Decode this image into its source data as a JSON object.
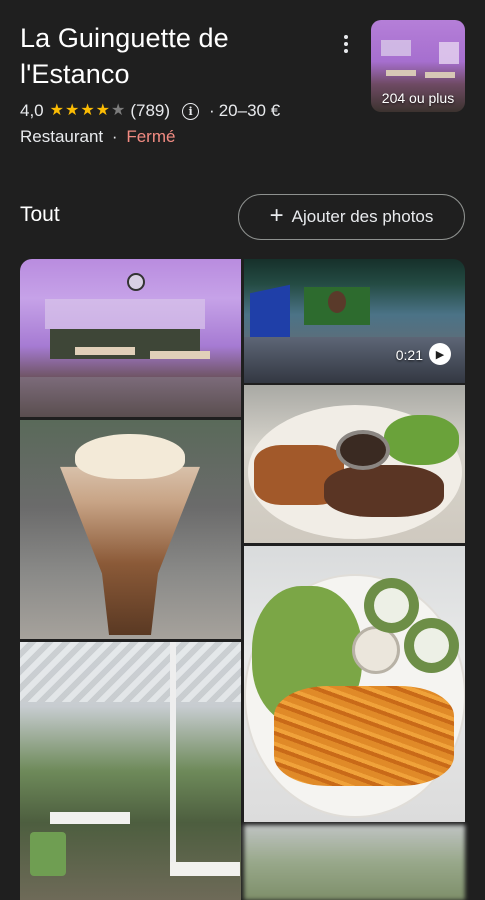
{
  "place": {
    "name": "La Guinguette de l'Estanco",
    "rating": "4,0",
    "stars": {
      "value": 4,
      "max": 5
    },
    "review_count": "(789)",
    "price_separator": "·",
    "price_range": "20–30 €",
    "category": "Restaurant",
    "category_separator": "·",
    "status": "Fermé"
  },
  "thumbnail": {
    "label": "204 ou plus"
  },
  "photos_section": {
    "title": "Tout",
    "add_photos_label": "Ajouter des photos"
  },
  "video": {
    "duration": "0:21"
  },
  "colors": {
    "background": "#1f1f1f",
    "star_active": "#fbbc04",
    "status_closed": "#f28b82",
    "button_border": "#8e918f"
  },
  "icons": [
    "more-vert-icon",
    "info-icon",
    "star-icon",
    "plus-icon",
    "play-icon"
  ]
}
